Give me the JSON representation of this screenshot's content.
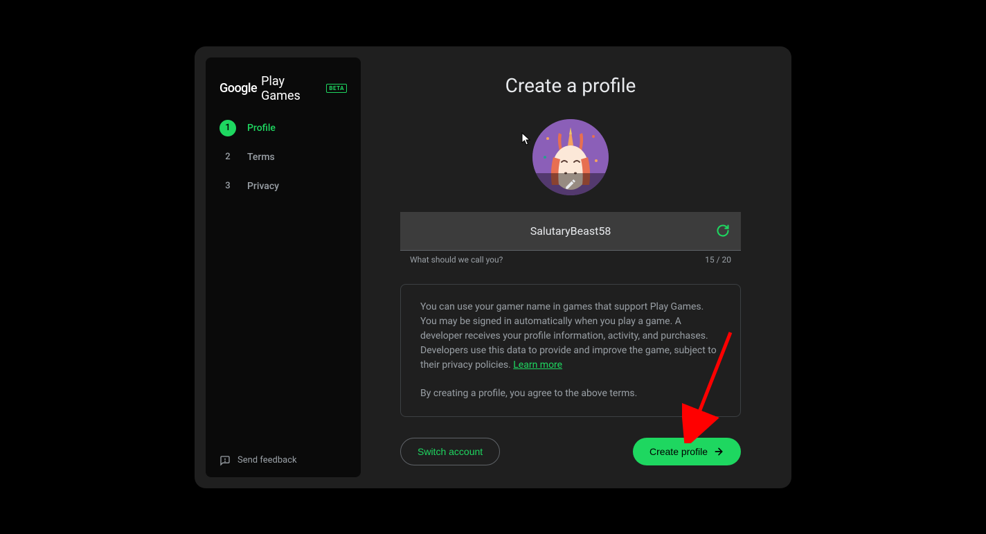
{
  "brand": {
    "google": "Google",
    "product": "Play Games",
    "badge": "BETA"
  },
  "steps": [
    {
      "num": "1",
      "label": "Profile",
      "active": true
    },
    {
      "num": "2",
      "label": "Terms",
      "active": false
    },
    {
      "num": "3",
      "label": "Privacy",
      "active": false
    }
  ],
  "feedback_label": "Send feedback",
  "title": "Create a profile",
  "username": "SalutaryBeast58",
  "field_hint": "What should we call you?",
  "char_count": "15 / 20",
  "info_paragraph": "You can use your gamer name in games that support Play Games. You may be signed in automatically when you play a game. A developer receives your profile information, activity, and purchases. Developers use this data to provide and improve the game, subject to their privacy policies. ",
  "learn_more": "Learn more",
  "agreement_text": "By creating a profile, you agree to the above terms.",
  "switch_account_label": "Switch account",
  "create_profile_label": "Create profile"
}
